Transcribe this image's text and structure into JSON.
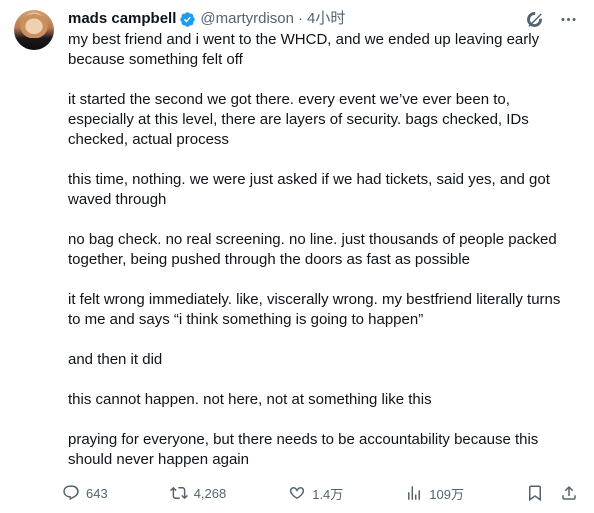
{
  "author": {
    "display_name": "mads campbell",
    "handle": "@martyrdison",
    "separator": "·",
    "timestamp": "4小时"
  },
  "tweet": {
    "paragraphs": [
      "my best friend and i went to the WHCD, and we ended up leaving early because something felt off",
      "it started the second we got there. every event we’ve ever been to, especially at this level, there are layers of security. bags checked, IDs checked, actual process",
      "this time, nothing. we were just asked if we had tickets, said yes, and got waved through",
      "no bag check. no real screening. no line. just thousands of people packed together, being pushed through the doors as fast as possible",
      "it felt wrong immediately. like, viscerally wrong. my bestfriend literally turns to me and says “i think something is going to happen”",
      "and then it did",
      "this cannot happen. not here, not at something like this",
      "praying for everyone, but there needs to be accountability because this should never happen again"
    ]
  },
  "metrics": {
    "replies": "643",
    "reposts": "4,268",
    "likes": "1.4万",
    "views": "109万"
  },
  "icons": {
    "verified": "verified-badge-icon",
    "grok": "grok-icon",
    "more": "more-icon",
    "reply": "reply-icon",
    "repost": "repost-icon",
    "like": "like-icon",
    "views": "views-icon",
    "bookmark": "bookmark-icon",
    "share": "share-icon"
  },
  "colors": {
    "verified": "#1d9bf0",
    "text": "#0f1419",
    "secondary": "#536471"
  }
}
